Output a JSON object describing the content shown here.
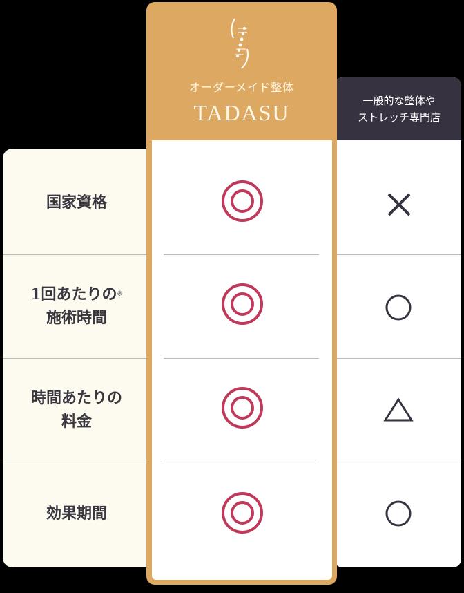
{
  "tadasu": {
    "subtitle": "オーダーメイド整体",
    "name": "TADASU"
  },
  "other": {
    "line1": "一般的な整体や",
    "line2": "ストレッチ専門店"
  },
  "rows": [
    {
      "label1": "国家資格",
      "label2": "",
      "note": "",
      "tadasu": "double-circle",
      "other": "cross"
    },
    {
      "label1": "1回あたりの",
      "label2": "施術時間",
      "note": "※",
      "tadasu": "double-circle",
      "other": "circle"
    },
    {
      "label1": "時間あたりの",
      "label2": "料金",
      "note": "",
      "tadasu": "double-circle",
      "other": "triangle"
    },
    {
      "label1": "効果期間",
      "label2": "",
      "note": "",
      "tadasu": "double-circle",
      "other": "circle"
    }
  ],
  "colors": {
    "gold": "#dca862",
    "dark": "#36323f",
    "red": "#c0395a",
    "cream": "#fdfbef"
  }
}
